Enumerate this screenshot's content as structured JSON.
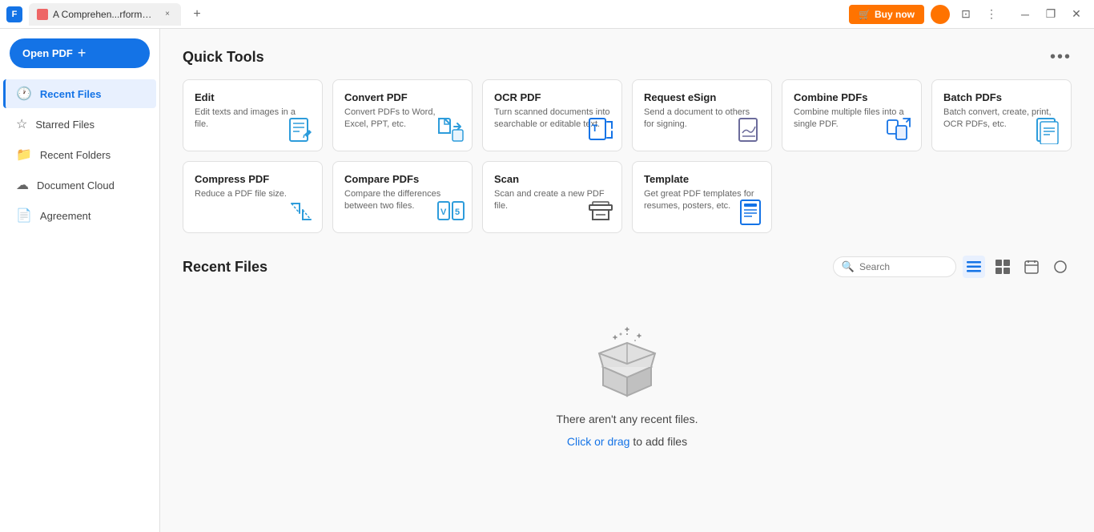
{
  "titlebar": {
    "logo_label": "F",
    "tab_name": "A Comprehen...rformance.pdf",
    "tab_close": "×",
    "tab_add": "+",
    "buy_now_label": "Buy now",
    "win_minimize": "—",
    "win_restore": "❐",
    "win_close": "×"
  },
  "sidebar": {
    "open_pdf_label": "Open PDF",
    "plus_label": "+",
    "items": [
      {
        "id": "recent-files",
        "label": "Recent Files",
        "icon": "🕐",
        "active": true
      },
      {
        "id": "starred-files",
        "label": "Starred Files",
        "icon": "☆",
        "active": false
      },
      {
        "id": "recent-folders",
        "label": "Recent Folders",
        "icon": "📁",
        "active": false
      },
      {
        "id": "document-cloud",
        "label": "Document Cloud",
        "icon": "☁",
        "active": false
      },
      {
        "id": "agreement",
        "label": "Agreement",
        "icon": "📄",
        "active": false
      }
    ]
  },
  "quick_tools": {
    "title": "Quick Tools",
    "more_label": "•••",
    "tools": [
      {
        "id": "edit",
        "title": "Edit",
        "desc": "Edit texts and images in a file.",
        "icon_type": "edit"
      },
      {
        "id": "convert-pdf",
        "title": "Convert PDF",
        "desc": "Convert PDFs to Word, Excel, PPT, etc.",
        "icon_type": "convert"
      },
      {
        "id": "ocr-pdf",
        "title": "OCR PDF",
        "desc": "Turn scanned documents into searchable or editable text.",
        "icon_type": "ocr"
      },
      {
        "id": "request-esign",
        "title": "Request eSign",
        "desc": "Send a document to others for signing.",
        "icon_type": "esign"
      },
      {
        "id": "combine-pdfs",
        "title": "Combine PDFs",
        "desc": "Combine multiple files into a single PDF.",
        "icon_type": "combine"
      },
      {
        "id": "batch-pdfs",
        "title": "Batch PDFs",
        "desc": "Batch convert, create, print, OCR PDFs, etc.",
        "icon_type": "batch"
      },
      {
        "id": "compress-pdf",
        "title": "Compress PDF",
        "desc": "Reduce a PDF file size.",
        "icon_type": "compress"
      },
      {
        "id": "compare-pdfs",
        "title": "Compare PDFs",
        "desc": "Compare the differences between two files.",
        "icon_type": "compare"
      },
      {
        "id": "scan",
        "title": "Scan",
        "desc": "Scan and create a new PDF file.",
        "icon_type": "scan"
      },
      {
        "id": "template",
        "title": "Template",
        "desc": "Get great PDF templates for resumes, posters, etc.",
        "icon_type": "template"
      }
    ]
  },
  "recent_files": {
    "title": "Recent Files",
    "search_placeholder": "Search",
    "empty_title": "There aren't any recent files.",
    "empty_sub": "Click or drag",
    "empty_sub2": " to add files"
  }
}
